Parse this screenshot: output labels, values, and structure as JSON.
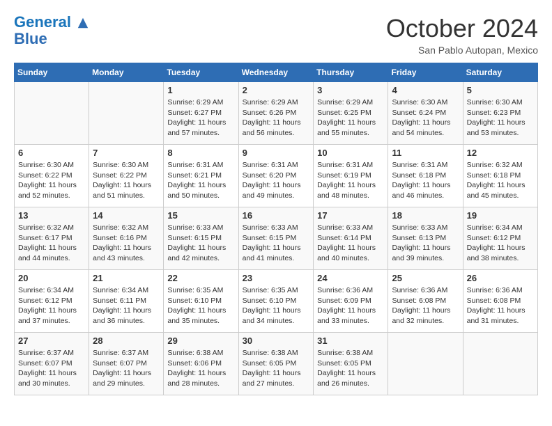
{
  "header": {
    "logo_line1": "General",
    "logo_line2": "Blue",
    "month": "October 2024",
    "location": "San Pablo Autopan, Mexico"
  },
  "weekdays": [
    "Sunday",
    "Monday",
    "Tuesday",
    "Wednesday",
    "Thursday",
    "Friday",
    "Saturday"
  ],
  "weeks": [
    [
      {
        "day": "",
        "sunrise": "",
        "sunset": "",
        "daylight": ""
      },
      {
        "day": "",
        "sunrise": "",
        "sunset": "",
        "daylight": ""
      },
      {
        "day": "1",
        "sunrise": "Sunrise: 6:29 AM",
        "sunset": "Sunset: 6:27 PM",
        "daylight": "Daylight: 11 hours and 57 minutes."
      },
      {
        "day": "2",
        "sunrise": "Sunrise: 6:29 AM",
        "sunset": "Sunset: 6:26 PM",
        "daylight": "Daylight: 11 hours and 56 minutes."
      },
      {
        "day": "3",
        "sunrise": "Sunrise: 6:29 AM",
        "sunset": "Sunset: 6:25 PM",
        "daylight": "Daylight: 11 hours and 55 minutes."
      },
      {
        "day": "4",
        "sunrise": "Sunrise: 6:30 AM",
        "sunset": "Sunset: 6:24 PM",
        "daylight": "Daylight: 11 hours and 54 minutes."
      },
      {
        "day": "5",
        "sunrise": "Sunrise: 6:30 AM",
        "sunset": "Sunset: 6:23 PM",
        "daylight": "Daylight: 11 hours and 53 minutes."
      }
    ],
    [
      {
        "day": "6",
        "sunrise": "Sunrise: 6:30 AM",
        "sunset": "Sunset: 6:22 PM",
        "daylight": "Daylight: 11 hours and 52 minutes."
      },
      {
        "day": "7",
        "sunrise": "Sunrise: 6:30 AM",
        "sunset": "Sunset: 6:22 PM",
        "daylight": "Daylight: 11 hours and 51 minutes."
      },
      {
        "day": "8",
        "sunrise": "Sunrise: 6:31 AM",
        "sunset": "Sunset: 6:21 PM",
        "daylight": "Daylight: 11 hours and 50 minutes."
      },
      {
        "day": "9",
        "sunrise": "Sunrise: 6:31 AM",
        "sunset": "Sunset: 6:20 PM",
        "daylight": "Daylight: 11 hours and 49 minutes."
      },
      {
        "day": "10",
        "sunrise": "Sunrise: 6:31 AM",
        "sunset": "Sunset: 6:19 PM",
        "daylight": "Daylight: 11 hours and 48 minutes."
      },
      {
        "day": "11",
        "sunrise": "Sunrise: 6:31 AM",
        "sunset": "Sunset: 6:18 PM",
        "daylight": "Daylight: 11 hours and 46 minutes."
      },
      {
        "day": "12",
        "sunrise": "Sunrise: 6:32 AM",
        "sunset": "Sunset: 6:18 PM",
        "daylight": "Daylight: 11 hours and 45 minutes."
      }
    ],
    [
      {
        "day": "13",
        "sunrise": "Sunrise: 6:32 AM",
        "sunset": "Sunset: 6:17 PM",
        "daylight": "Daylight: 11 hours and 44 minutes."
      },
      {
        "day": "14",
        "sunrise": "Sunrise: 6:32 AM",
        "sunset": "Sunset: 6:16 PM",
        "daylight": "Daylight: 11 hours and 43 minutes."
      },
      {
        "day": "15",
        "sunrise": "Sunrise: 6:33 AM",
        "sunset": "Sunset: 6:15 PM",
        "daylight": "Daylight: 11 hours and 42 minutes."
      },
      {
        "day": "16",
        "sunrise": "Sunrise: 6:33 AM",
        "sunset": "Sunset: 6:15 PM",
        "daylight": "Daylight: 11 hours and 41 minutes."
      },
      {
        "day": "17",
        "sunrise": "Sunrise: 6:33 AM",
        "sunset": "Sunset: 6:14 PM",
        "daylight": "Daylight: 11 hours and 40 minutes."
      },
      {
        "day": "18",
        "sunrise": "Sunrise: 6:33 AM",
        "sunset": "Sunset: 6:13 PM",
        "daylight": "Daylight: 11 hours and 39 minutes."
      },
      {
        "day": "19",
        "sunrise": "Sunrise: 6:34 AM",
        "sunset": "Sunset: 6:12 PM",
        "daylight": "Daylight: 11 hours and 38 minutes."
      }
    ],
    [
      {
        "day": "20",
        "sunrise": "Sunrise: 6:34 AM",
        "sunset": "Sunset: 6:12 PM",
        "daylight": "Daylight: 11 hours and 37 minutes."
      },
      {
        "day": "21",
        "sunrise": "Sunrise: 6:34 AM",
        "sunset": "Sunset: 6:11 PM",
        "daylight": "Daylight: 11 hours and 36 minutes."
      },
      {
        "day": "22",
        "sunrise": "Sunrise: 6:35 AM",
        "sunset": "Sunset: 6:10 PM",
        "daylight": "Daylight: 11 hours and 35 minutes."
      },
      {
        "day": "23",
        "sunrise": "Sunrise: 6:35 AM",
        "sunset": "Sunset: 6:10 PM",
        "daylight": "Daylight: 11 hours and 34 minutes."
      },
      {
        "day": "24",
        "sunrise": "Sunrise: 6:36 AM",
        "sunset": "Sunset: 6:09 PM",
        "daylight": "Daylight: 11 hours and 33 minutes."
      },
      {
        "day": "25",
        "sunrise": "Sunrise: 6:36 AM",
        "sunset": "Sunset: 6:08 PM",
        "daylight": "Daylight: 11 hours and 32 minutes."
      },
      {
        "day": "26",
        "sunrise": "Sunrise: 6:36 AM",
        "sunset": "Sunset: 6:08 PM",
        "daylight": "Daylight: 11 hours and 31 minutes."
      }
    ],
    [
      {
        "day": "27",
        "sunrise": "Sunrise: 6:37 AM",
        "sunset": "Sunset: 6:07 PM",
        "daylight": "Daylight: 11 hours and 30 minutes."
      },
      {
        "day": "28",
        "sunrise": "Sunrise: 6:37 AM",
        "sunset": "Sunset: 6:07 PM",
        "daylight": "Daylight: 11 hours and 29 minutes."
      },
      {
        "day": "29",
        "sunrise": "Sunrise: 6:38 AM",
        "sunset": "Sunset: 6:06 PM",
        "daylight": "Daylight: 11 hours and 28 minutes."
      },
      {
        "day": "30",
        "sunrise": "Sunrise: 6:38 AM",
        "sunset": "Sunset: 6:05 PM",
        "daylight": "Daylight: 11 hours and 27 minutes."
      },
      {
        "day": "31",
        "sunrise": "Sunrise: 6:38 AM",
        "sunset": "Sunset: 6:05 PM",
        "daylight": "Daylight: 11 hours and 26 minutes."
      },
      {
        "day": "",
        "sunrise": "",
        "sunset": "",
        "daylight": ""
      },
      {
        "day": "",
        "sunrise": "",
        "sunset": "",
        "daylight": ""
      }
    ]
  ]
}
